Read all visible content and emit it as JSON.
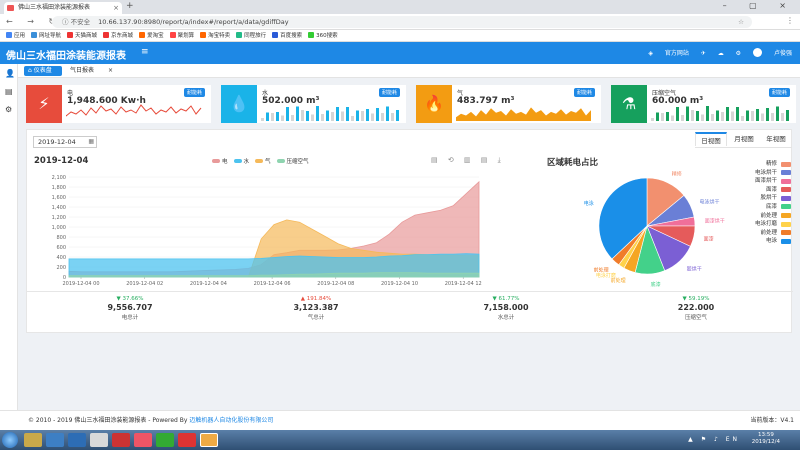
{
  "browser": {
    "tab_title": "佛山三水福田涂装能源报表",
    "tab_close": "×",
    "new_tab": "+",
    "window_controls": "– ▢ ×",
    "nav_buttons": "← → ↻",
    "security_label": "ⓘ 不安全",
    "url": "10.66.137.90:8980/report/a/index#/report/a/data/gdiffDay",
    "menu_icon": "⋮",
    "bookmarks": [
      {
        "label": "应用",
        "color": "#4285f4"
      },
      {
        "label": "网址导航",
        "color": "#3b8fd9"
      },
      {
        "label": "天猫商城",
        "color": "#e33"
      },
      {
        "label": "京东商城",
        "color": "#e33"
      },
      {
        "label": "爱淘宝",
        "color": "#f60"
      },
      {
        "label": "聚划算",
        "color": "#f44"
      },
      {
        "label": "淘宝特卖",
        "color": "#f60"
      },
      {
        "label": "同程旅行",
        "color": "#2b8"
      },
      {
        "label": "百度搜索",
        "color": "#2a5bd7"
      },
      {
        "label": "360搜索",
        "color": "#3c3"
      }
    ]
  },
  "app": {
    "title": "佛山三水福田涂装能源报表",
    "menu_icon": "≡",
    "official_site": "官方网站",
    "user": "卢俊强",
    "header_icons": [
      "✈",
      "☁",
      "⚙"
    ]
  },
  "tabs": [
    "仪表盘",
    "气日报表"
  ],
  "tab_close": "×",
  "cards": [
    {
      "label": "电",
      "value": "1,948.600 Kw·h",
      "badge": "耐能耗",
      "color": "#e74c3c",
      "icon": "⚡"
    },
    {
      "label": "水",
      "value": "502.000 m³",
      "badge": "耐能耗",
      "color": "#1ab3e8",
      "icon": "💧"
    },
    {
      "label": "气",
      "value": "483.797 m³",
      "badge": "耐能耗",
      "color": "#f39c12",
      "icon": "🔥"
    },
    {
      "label": "压缩空气",
      "value": "60.000 m³",
      "badge": "耐能耗",
      "color": "#16a05d",
      "icon": "⚗"
    }
  ],
  "main": {
    "date_value": "2019-12-04",
    "date_icon": "▦",
    "view_buttons": [
      "日视图",
      "月视图",
      "年视图"
    ],
    "chart_title": "2019-12-04",
    "pie_title": "区域耗电占比",
    "toolbar_icons": "▤ ⟲ ▥ ▤ ⤓"
  },
  "chart_data": [
    {
      "type": "area",
      "title": "2019-12-04",
      "legend": [
        "电",
        "水",
        "气",
        "压缩空气"
      ],
      "colors": [
        "#e89a9a",
        "#4dc3ef",
        "#f5b95a",
        "#8fd4b0"
      ],
      "x": [
        "2019-12-04 00",
        "2019-12-04 02",
        "2019-12-04 04",
        "2019-12-04 06",
        "2019-12-04 08",
        "2019-12-04 10",
        "2019-12-04 12"
      ],
      "yticks": [
        "2,100",
        "1,800",
        "1,600",
        "1,400",
        "1,200",
        "1,000",
        "800",
        "600",
        "400",
        "200",
        "0"
      ],
      "ylim": [
        0,
        2100
      ],
      "series": [
        {
          "name": "电",
          "values": [
            120,
            110,
            110,
            110,
            110,
            110,
            110,
            110,
            110,
            120,
            130,
            140,
            150,
            160,
            180,
            260,
            470,
            510,
            560,
            560,
            560,
            570,
            600,
            650,
            720,
            900,
            1150,
            1300,
            1350,
            1400,
            1500,
            1750,
            2000
          ]
        },
        {
          "name": "水",
          "values": [
            380,
            380,
            380,
            380,
            380,
            380,
            380,
            380,
            380,
            380,
            380,
            380,
            380,
            380,
            380,
            390,
            410,
            430,
            440,
            430,
            420,
            410,
            410,
            410,
            420,
            440,
            450,
            470,
            470,
            480,
            480,
            490,
            480
          ]
        },
        {
          "name": "气",
          "values": [
            0,
            0,
            0,
            0,
            0,
            0,
            0,
            0,
            0,
            0,
            0,
            0,
            0,
            0,
            0,
            800,
            1100,
            1200,
            1150,
            1000,
            850,
            700,
            600,
            560,
            520,
            500,
            480,
            480,
            470,
            460,
            460,
            450,
            450
          ]
        },
        {
          "name": "压缩空气",
          "values": [
            30,
            30,
            30,
            30,
            30,
            30,
            30,
            30,
            30,
            30,
            30,
            30,
            30,
            30,
            30,
            40,
            40,
            50,
            60,
            60,
            70,
            80,
            80,
            80,
            90,
            90,
            90,
            90,
            80,
            80,
            80,
            80,
            80
          ]
        }
      ]
    },
    {
      "type": "pie",
      "title": "区域耗电占比",
      "labels": [
        "精修",
        "电泳烘干",
        "面漆烘干",
        "面漆",
        "胶烘干",
        "底漆",
        "前处理",
        "电泳打磨",
        "前处理",
        "电泳"
      ],
      "colors": [
        "#f2906f",
        "#6a7fd6",
        "#f06f9a",
        "#e55b5b",
        "#7b5fd4",
        "#43d18a",
        "#f5a623",
        "#ffd24a",
        "#f07c2a",
        "#1a8fe8"
      ],
      "values": [
        14,
        8,
        3,
        7,
        12,
        10,
        4,
        2,
        3,
        37
      ],
      "slice_labels": [
        "精修",
        "电泳烘干",
        "面漆烘干",
        "面漆",
        "胶烘干",
        "底漆",
        "前处理",
        "电泳打磨",
        "前处理",
        "电泳"
      ]
    }
  ],
  "stats": [
    {
      "pct": "▼ 37.66%",
      "dir": "down",
      "num": "9,556.707",
      "label": "电总计"
    },
    {
      "pct": "▲ 191.84%",
      "dir": "up",
      "num": "3,123.387",
      "label": "气总计"
    },
    {
      "pct": "▼ 61.77%",
      "dir": "down",
      "num": "7,158.000",
      "label": "水总计"
    },
    {
      "pct": "▼ 59.19%",
      "dir": "down",
      "num": "222.000",
      "label": "压缩空气"
    }
  ],
  "footer": {
    "copyright": "© 2010 - 2019 佛山三水福田涂装能源报表 - Powered By",
    "company": "迈触机器人自动化股份有限公司",
    "version": "当前版本：V4.1"
  },
  "taskbar": {
    "time": "13:59",
    "date": "2019/12/4",
    "tray": "▲ ⚑ ♪ EN"
  }
}
